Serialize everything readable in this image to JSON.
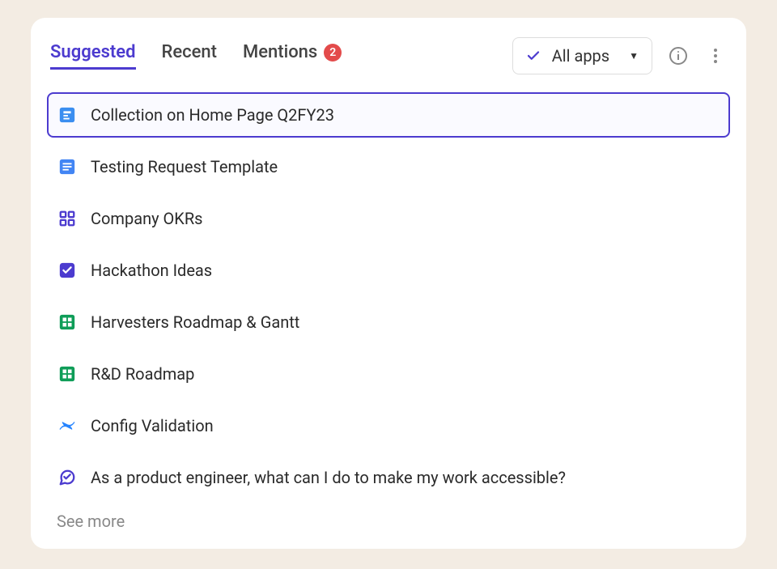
{
  "tabs": {
    "suggested": "Suggested",
    "recent": "Recent",
    "mentions": "Mentions",
    "mentions_count": "2"
  },
  "filter": {
    "label": "All apps"
  },
  "items": [
    {
      "title": "Collection on Home Page Q2FY23",
      "icon": "collection",
      "selected": true
    },
    {
      "title": "Testing Request Template",
      "icon": "doc",
      "selected": false
    },
    {
      "title": "Company OKRs",
      "icon": "grid",
      "selected": false
    },
    {
      "title": "Hackathon Ideas",
      "icon": "answer",
      "selected": false
    },
    {
      "title": "Harvesters Roadmap & Gantt",
      "icon": "sheet",
      "selected": false
    },
    {
      "title": "R&D Roadmap",
      "icon": "sheet",
      "selected": false
    },
    {
      "title": "Config Validation",
      "icon": "confluence",
      "selected": false
    },
    {
      "title": "As a product engineer, what can I do to make my work accessible?",
      "icon": "bubble",
      "selected": false
    }
  ],
  "see_more": "See more"
}
